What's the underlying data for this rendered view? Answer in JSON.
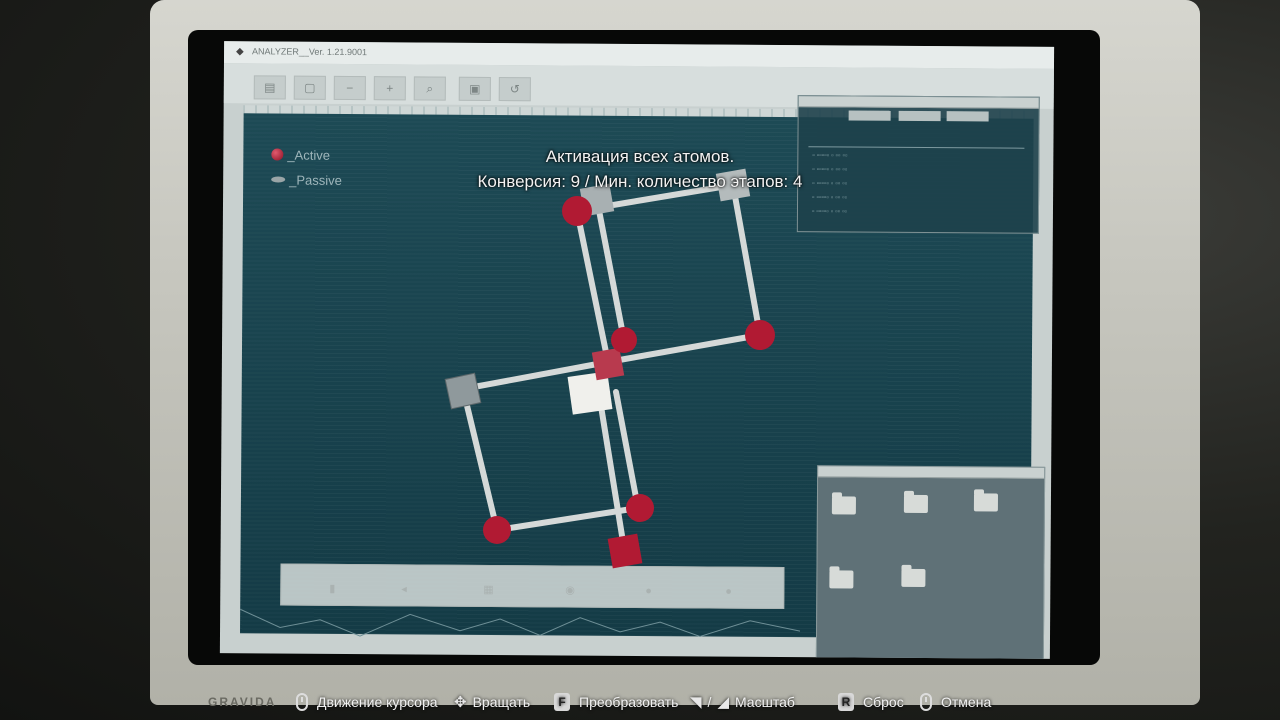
{
  "window": {
    "title": "ANALYZER__Ver. 1.21.9001"
  },
  "toolbar": {
    "buttons": [
      "save",
      "open",
      "minus",
      "plus",
      "search",
      "lock",
      "undo"
    ]
  },
  "legend": {
    "active_label": "_Active",
    "passive_label": "_Passive"
  },
  "overlay": {
    "line1": "Активация всех атомов.",
    "line2": "Конверсия: 9 / Мин. количество этапов: 4"
  },
  "hints": [
    {
      "icon": "mouse-icon",
      "label": "Движение курсора"
    },
    {
      "icon": "rotate-icon",
      "label": "Вращать"
    },
    {
      "key": "F",
      "label": "Преобразовать"
    },
    {
      "icon": "zoom-in-icon",
      "sep": "/",
      "icon2": "zoom-out-icon",
      "label": "Масштаб"
    },
    {
      "key": "R",
      "label": "Сброс"
    },
    {
      "icon": "mouse-right-icon",
      "label": "Отмена"
    }
  ],
  "monitor": {
    "brand": "GRAVIDA"
  },
  "colors": {
    "plot_bg": "#174452",
    "atom_active": "#b51a34",
    "atom_passive": "#c8cccc"
  }
}
